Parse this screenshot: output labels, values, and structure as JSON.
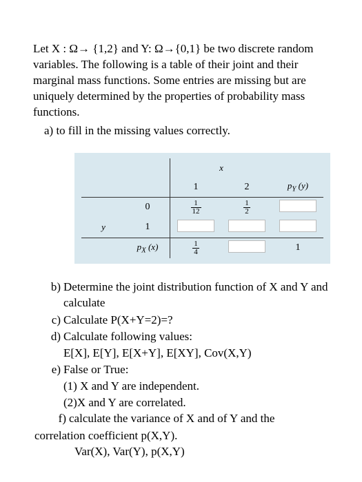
{
  "intro": "Let X : Ω→ {1,2} and Y: Ω→{0,1} be two discrete random variables. The following is a table of their joint and their marginal mass functions. Some entries are missing but are uniquely determined by the properties of probability mass functions.",
  "part_a": "a) to fill in the missing values correctly.",
  "table": {
    "x_label": "x",
    "y_label": "y",
    "col1": "1",
    "col2": "2",
    "py_label": "p_Y (y)",
    "row0_label": "0",
    "row0_c1_num": "1",
    "row0_c1_den": "12",
    "row0_c2_num": "1",
    "row0_c2_den": "2",
    "row1_label": "1",
    "px_label": "p_X (x)",
    "px_c1_num": "1",
    "px_c1_den": "4",
    "total": "1"
  },
  "b_label": "b)",
  "b_text": "Determine the joint distribution function of X and Y and calculate",
  "c_label": "c)",
  "c_text": "Calculate P(X+Y=2)=?",
  "d_label": "d)",
  "d_text": "Calculate following values:",
  "d_sub": "E[X], E[Y], E[X+Y], E[XY], Cov(X,Y)",
  "e_label": "e)",
  "e_text": "False or True:",
  "e_sub1": "(1) X and Y are independent.",
  "e_sub2": "(2)X and Y are correlated.",
  "f_label": "f)",
  "f_text": "calculate the variance of X and of  Y and the",
  "f_cont": "correlation coefficient p(X,Y).",
  "f_sub": "Var(X), Var(Y), p(X,Y)"
}
